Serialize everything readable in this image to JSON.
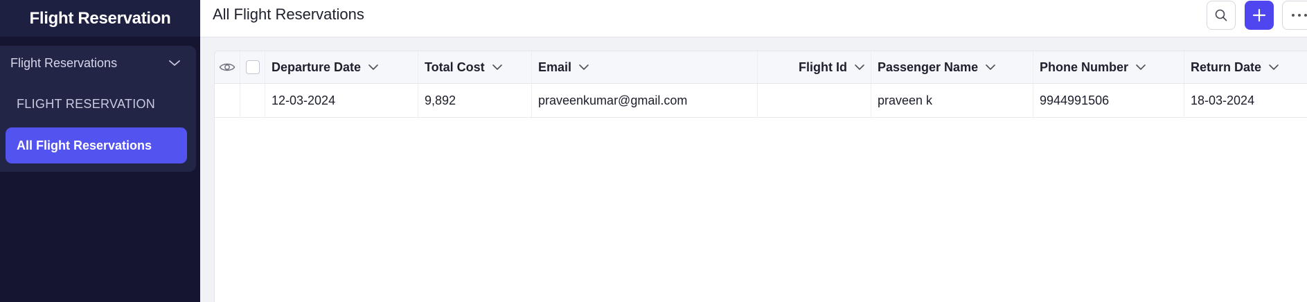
{
  "app": {
    "title": "Flight Reservation"
  },
  "sidebar": {
    "group_label": "Flight Reservations",
    "items": [
      {
        "label": "FLIGHT RESERVATION",
        "active": false
      },
      {
        "label": "All Flight Reservations",
        "active": true
      }
    ]
  },
  "header": {
    "page_title": "All Flight Reservations"
  },
  "toolbar": {
    "icons": [
      "search-icon",
      "plus-icon",
      "more-icon"
    ]
  },
  "table": {
    "columns": [
      "Departure Date",
      "Total Cost",
      "Email",
      "Flight Id",
      "Passenger Name",
      "Phone Number",
      "Return Date"
    ],
    "rows": [
      {
        "departure_date": "12-03-2024",
        "total_cost": "9,892",
        "email": "praveenkumar@gmail.com",
        "flight_id": "",
        "passenger_name": "praveen k",
        "phone_number": "9944991506",
        "return_date": "18-03-2024"
      }
    ]
  },
  "colors": {
    "accent": "#4f46ef",
    "sidebar_bg": "#15152f",
    "active_item": "#5353f0"
  }
}
